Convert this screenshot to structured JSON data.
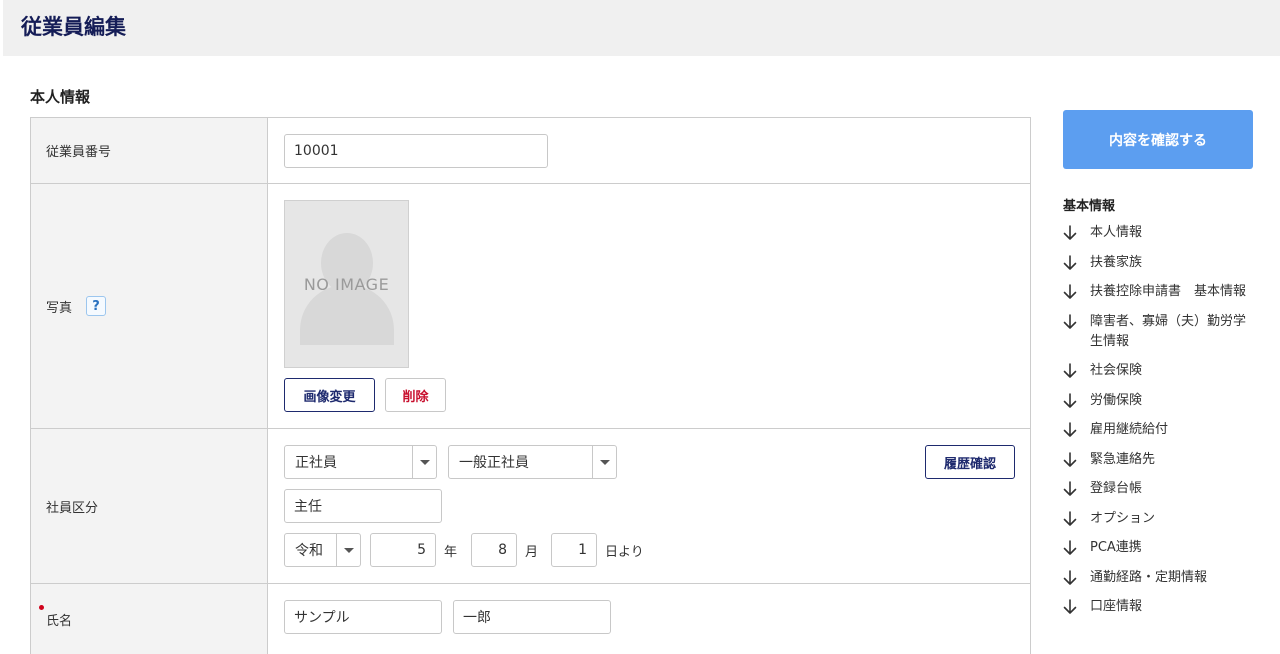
{
  "page_title": "従業員編集",
  "section_title": "本人情報",
  "rows": {
    "employee_number": {
      "label": "従業員番号",
      "value": "10001"
    },
    "photo": {
      "label": "写真",
      "help": "?",
      "no_image": "NO IMAGE",
      "change_button": "画像変更",
      "delete_button": "削除"
    },
    "employee_type": {
      "label": "社員区分",
      "type_select": "正社員",
      "subtype_select": "一般正社員",
      "history_button": "履歴確認",
      "position": "主任",
      "era_select": "令和",
      "year": "5",
      "year_unit": "年",
      "month": "8",
      "month_unit": "月",
      "day": "1",
      "day_unit": "日より"
    },
    "name": {
      "label": "氏名",
      "last_name": "サンプル",
      "first_name": "一郎"
    }
  },
  "sidebar": {
    "confirm_button": "内容を確認する",
    "heading": "基本情報",
    "items": [
      "本人情報",
      "扶養家族",
      "扶養控除申請書　基本情報",
      "障害者、寡婦（夫）勤労学生情報",
      "社会保険",
      "労働保険",
      "雇用継続給付",
      "緊急連絡先",
      "登録台帳",
      "オプション",
      "PCA連携",
      "通勤経路・定期情報",
      "口座情報"
    ]
  },
  "colors": {
    "title": "#151d57",
    "accent": "#5c9ef0",
    "navy": "#1e2a6e",
    "danger": "#c8102e"
  }
}
